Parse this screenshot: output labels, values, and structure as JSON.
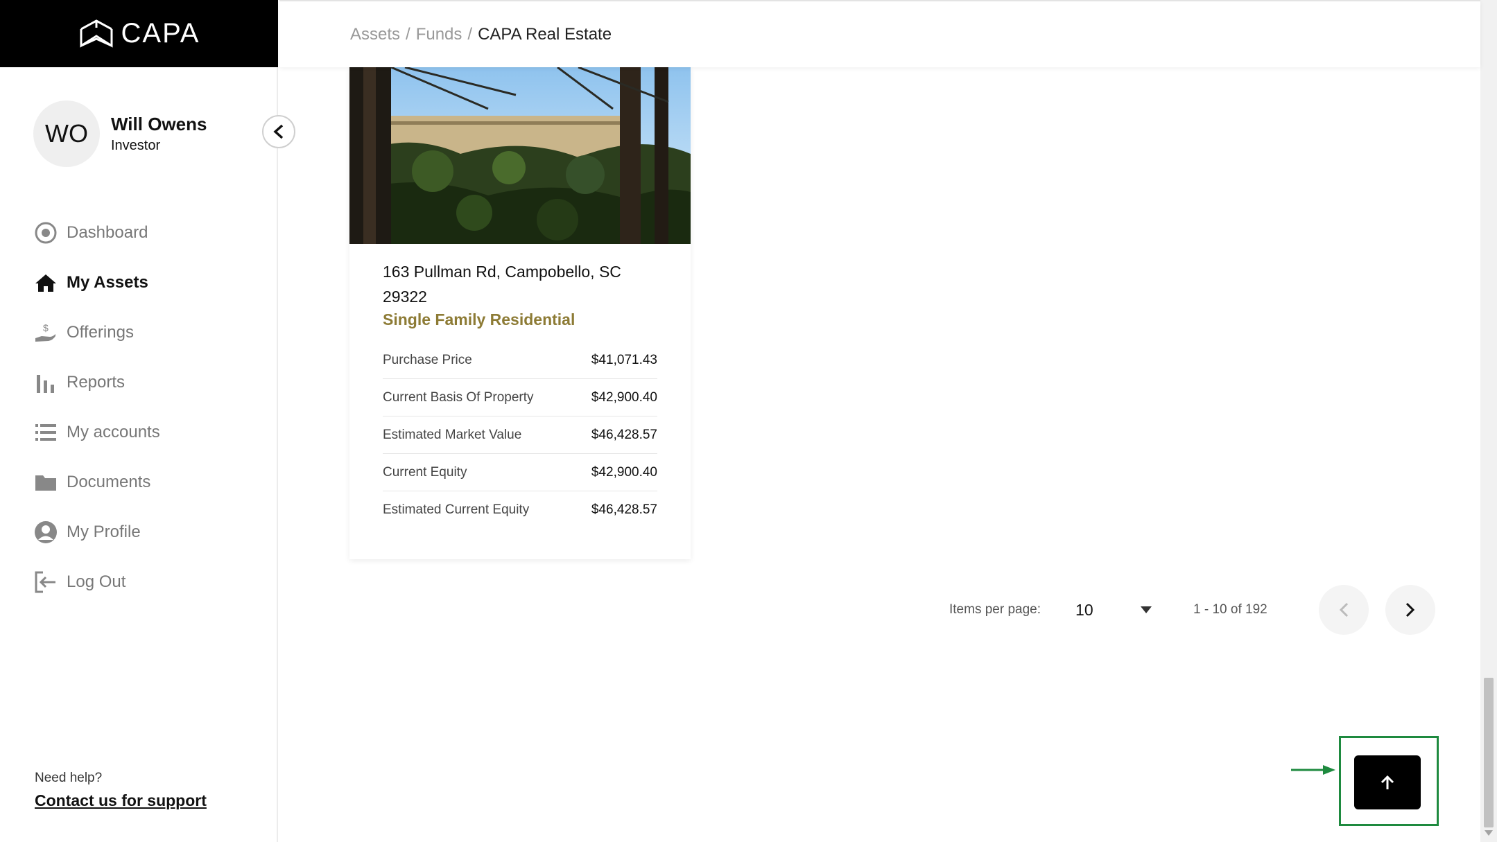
{
  "brand": {
    "name": "CAPA"
  },
  "user": {
    "initials": "WO",
    "name": "Will Owens",
    "role": "Investor"
  },
  "nav": [
    {
      "label": "Dashboard",
      "icon": "dashboard-icon",
      "active": false
    },
    {
      "label": "My Assets",
      "icon": "home-icon",
      "active": true
    },
    {
      "label": "Offerings",
      "icon": "offerings-icon",
      "active": false
    },
    {
      "label": "Reports",
      "icon": "bar-chart-icon",
      "active": false
    },
    {
      "label": "My accounts",
      "icon": "list-icon",
      "active": false
    },
    {
      "label": "Documents",
      "icon": "folder-icon",
      "active": false
    },
    {
      "label": "My Profile",
      "icon": "user-icon",
      "active": false
    },
    {
      "label": "Log Out",
      "icon": "logout-icon",
      "active": false
    }
  ],
  "help": {
    "label": "Need help?",
    "link": "Contact us for support"
  },
  "breadcrumb": {
    "items": [
      "Assets",
      "Funds"
    ],
    "current": "CAPA Real Estate",
    "separator": "/"
  },
  "asset": {
    "address": "163 Pullman Rd, Campobello, SC 29322",
    "type": "Single Family Residential",
    "rows": [
      {
        "label": "Purchase Price",
        "value": "$41,071.43"
      },
      {
        "label": "Current Basis Of Property",
        "value": "$42,900.40"
      },
      {
        "label": "Estimated Market Value",
        "value": "$46,428.57"
      },
      {
        "label": "Current Equity",
        "value": "$42,900.40"
      },
      {
        "label": "Estimated Current Equity",
        "value": "$46,428.57"
      }
    ]
  },
  "pagination": {
    "items_per_page_label": "Items per page:",
    "items_per_page": "10",
    "range": "1 - 10 of 192"
  },
  "colors": {
    "accent_gold": "#8d7b35",
    "annotation_green": "#1e8a3f"
  }
}
